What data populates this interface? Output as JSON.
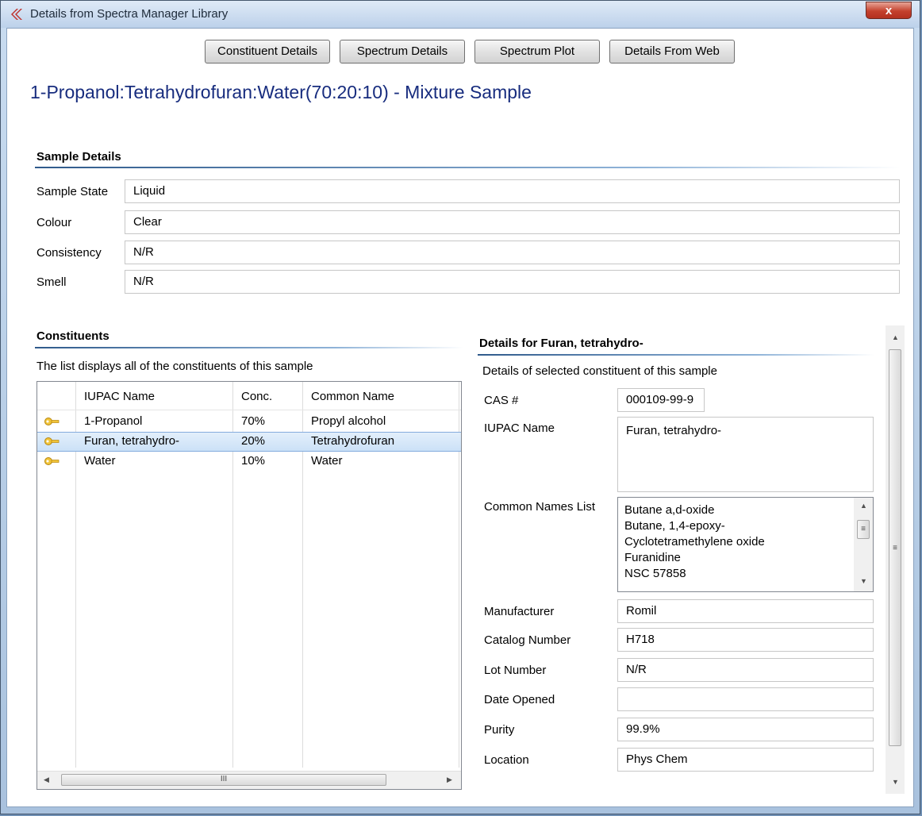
{
  "window": {
    "title": "Details from Spectra Manager Library",
    "close_label": "x"
  },
  "toolbar": {
    "buttons": [
      "Constituent Details",
      "Spectrum Details",
      "Spectrum Plot",
      "Details From Web"
    ]
  },
  "heading": "1-Propanol:Tetrahydrofuran:Water(70:20:10) - Mixture Sample",
  "sample_details": {
    "title": "Sample Details",
    "fields": [
      {
        "label": "Sample State",
        "value": "Liquid"
      },
      {
        "label": "Colour",
        "value": "Clear"
      },
      {
        "label": "Consistency",
        "value": "N/R"
      },
      {
        "label": "Smell",
        "value": "N/R"
      }
    ]
  },
  "constituents": {
    "title": "Constituents",
    "description": "The list displays all of the constituents of this sample",
    "columns": [
      "IUPAC Name",
      "Conc.",
      "Common Name"
    ],
    "rows": [
      {
        "iupac": "1-Propanol",
        "conc": "70%",
        "common": "Propyl alcohol",
        "selected": false
      },
      {
        "iupac": "Furan, tetrahydro-",
        "conc": "20%",
        "common": "Tetrahydrofuran",
        "selected": true
      },
      {
        "iupac": "Water",
        "conc": "10%",
        "common": "Water",
        "selected": false
      }
    ],
    "hscroll_grip": "III"
  },
  "details": {
    "title": "Details for Furan, tetrahydro-",
    "description": "Details of selected constituent of this sample",
    "cas_label": "CAS #",
    "cas_value": "000109-99-9",
    "iupac_label": "IUPAC Name",
    "iupac_value": "Furan, tetrahydro-",
    "common_names_label": "Common Names List",
    "common_names": [
      "Butane a,d-oxide",
      "Butane, 1,4-epoxy-",
      "Cyclotetramethylene oxide",
      "Furanidine",
      "NSC 57858"
    ],
    "list_grip": "≡",
    "fields": [
      {
        "label": "Manufacturer",
        "value": "Romil"
      },
      {
        "label": "Catalog Number",
        "value": "H718"
      },
      {
        "label": "Lot Number",
        "value": "N/R"
      },
      {
        "label": "Date Opened",
        "value": ""
      },
      {
        "label": "Purity",
        "value": "99.9%"
      },
      {
        "label": "Location",
        "value": "Phys Chem"
      }
    ],
    "vscroll_grip": "≡"
  }
}
